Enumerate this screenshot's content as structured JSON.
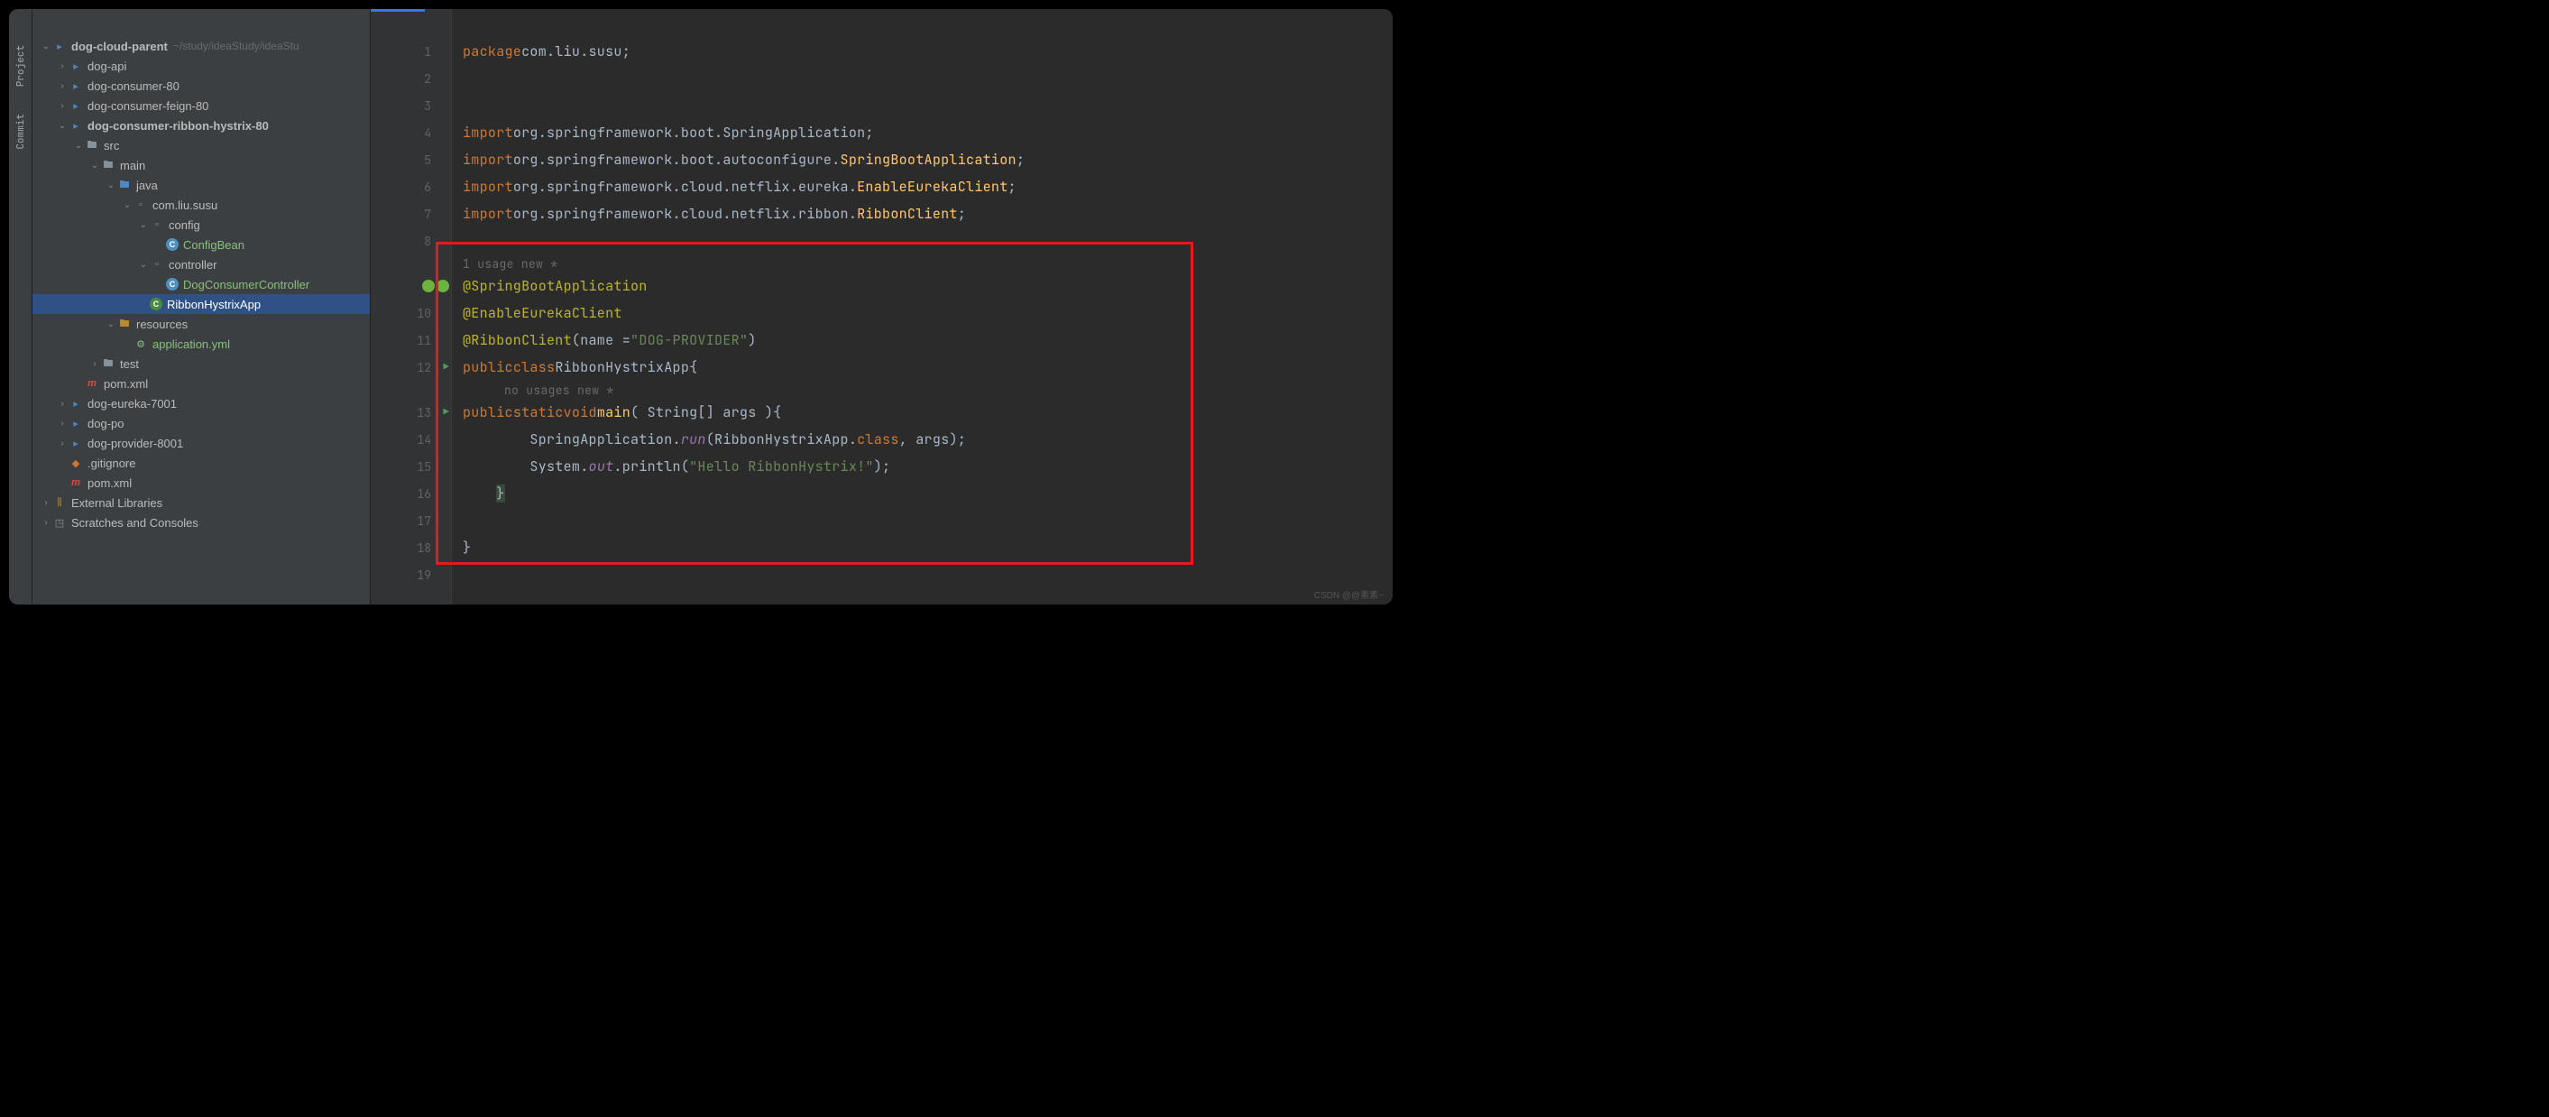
{
  "rail": {
    "project": "Project",
    "commit": "Commit"
  },
  "tree": {
    "root": {
      "name": "dog-cloud-parent",
      "hint": "~/study/ideaStudy/ideaStu"
    },
    "items": [
      {
        "indent": 1,
        "arrow": "›",
        "icon": "module",
        "label": "dog-api"
      },
      {
        "indent": 1,
        "arrow": "›",
        "icon": "module",
        "label": "dog-consumer-80"
      },
      {
        "indent": 1,
        "arrow": "›",
        "icon": "module",
        "label": "dog-consumer-feign-80"
      },
      {
        "indent": 1,
        "arrow": "⌄",
        "icon": "module",
        "label": "dog-consumer-ribbon-hystrix-80",
        "bold": true
      },
      {
        "indent": 2,
        "arrow": "⌄",
        "icon": "folder",
        "label": "src"
      },
      {
        "indent": 3,
        "arrow": "⌄",
        "icon": "folder",
        "label": "main"
      },
      {
        "indent": 4,
        "arrow": "⌄",
        "icon": "src-folder",
        "label": "java"
      },
      {
        "indent": 5,
        "arrow": "⌄",
        "icon": "pkg",
        "label": "com.liu.susu"
      },
      {
        "indent": 6,
        "arrow": "⌄",
        "icon": "pkg",
        "label": "config"
      },
      {
        "indent": 7,
        "arrow": "",
        "icon": "class-c",
        "label": "ConfigBean",
        "green": true
      },
      {
        "indent": 6,
        "arrow": "⌄",
        "icon": "pkg",
        "label": "controller"
      },
      {
        "indent": 7,
        "arrow": "",
        "icon": "class-c",
        "label": "DogConsumerController",
        "green": true
      },
      {
        "indent": 6,
        "arrow": "",
        "icon": "class-g",
        "label": "RibbonHystrixApp",
        "selected": true
      },
      {
        "indent": 4,
        "arrow": "⌄",
        "icon": "res-folder",
        "label": "resources"
      },
      {
        "indent": 5,
        "arrow": "",
        "icon": "yml",
        "label": "application.yml",
        "green": true
      },
      {
        "indent": 3,
        "arrow": "›",
        "icon": "folder",
        "label": "test"
      },
      {
        "indent": 2,
        "arrow": "",
        "icon": "mvn",
        "label": "pom.xml"
      },
      {
        "indent": 1,
        "arrow": "›",
        "icon": "module",
        "label": "dog-eureka-7001"
      },
      {
        "indent": 1,
        "arrow": "›",
        "icon": "module",
        "label": "dog-po"
      },
      {
        "indent": 1,
        "arrow": "›",
        "icon": "module",
        "label": "dog-provider-8001"
      },
      {
        "indent": 1,
        "arrow": "",
        "icon": "ignore",
        "label": ".gitignore"
      },
      {
        "indent": 1,
        "arrow": "",
        "icon": "mvn",
        "label": "pom.xml"
      }
    ],
    "external": "External Libraries",
    "scratches": "Scratches and Consoles"
  },
  "editor": {
    "hints": {
      "usage1": "1 usage   new *",
      "nousage": "no usages   new *"
    },
    "lines": {
      "l1": {
        "kw": "package ",
        "pkg": "com.liu.susu;"
      },
      "l4": {
        "kw": "import ",
        "p1": "org.springframework.boot.SpringApplication;"
      },
      "l5": {
        "kw": "import ",
        "p1": "org.springframework.boot.autoconfigure.",
        "cls": "SpringBootApplication",
        "end": ";"
      },
      "l6": {
        "kw": "import ",
        "p1": "org.springframework.cloud.netflix.eureka.",
        "cls": "EnableEurekaClient",
        "end": ";"
      },
      "l7": {
        "kw": "import ",
        "p1": "org.springframework.cloud.netflix.ribbon.",
        "cls": "RibbonClient",
        "end": ";"
      },
      "l9": "@SpringBootApplication",
      "l10": "@EnableEurekaClient",
      "l11": {
        "ann": "@RibbonClient",
        "txt1": "(name = ",
        "str": "\"DOG-PROVIDER\"",
        "txt2": ")"
      },
      "l12": {
        "kw1": "public ",
        "kw2": "class ",
        "name": "RibbonHystrixApp ",
        "br": "{"
      },
      "l13": {
        "ind": "    ",
        "kw1": "public ",
        "kw2": "static ",
        "kw3": "void ",
        "fn": "main",
        "args": "( String[] args ) ",
        "br": "{"
      },
      "l14": {
        "ind": "        ",
        "t1": "SpringApplication.",
        "it": "run",
        "t2": "(RibbonHystrixApp.",
        "kw": "class",
        "t3": ", args);"
      },
      "l15": {
        "ind": "        ",
        "t1": "System.",
        "it": "out",
        "t2": ".println( ",
        "str": "\"Hello RibbonHystrix!\"",
        "t3": " );"
      },
      "l16": {
        "ind": "    ",
        "br": "}"
      },
      "l18": "}"
    },
    "numbers": [
      "1",
      "2",
      "3",
      "4",
      "5",
      "6",
      "7",
      "8",
      "9",
      "10",
      "11",
      "12",
      "13",
      "14",
      "15",
      "16",
      "17",
      "18",
      "19"
    ]
  },
  "watermark": "CSDN @@素素~"
}
